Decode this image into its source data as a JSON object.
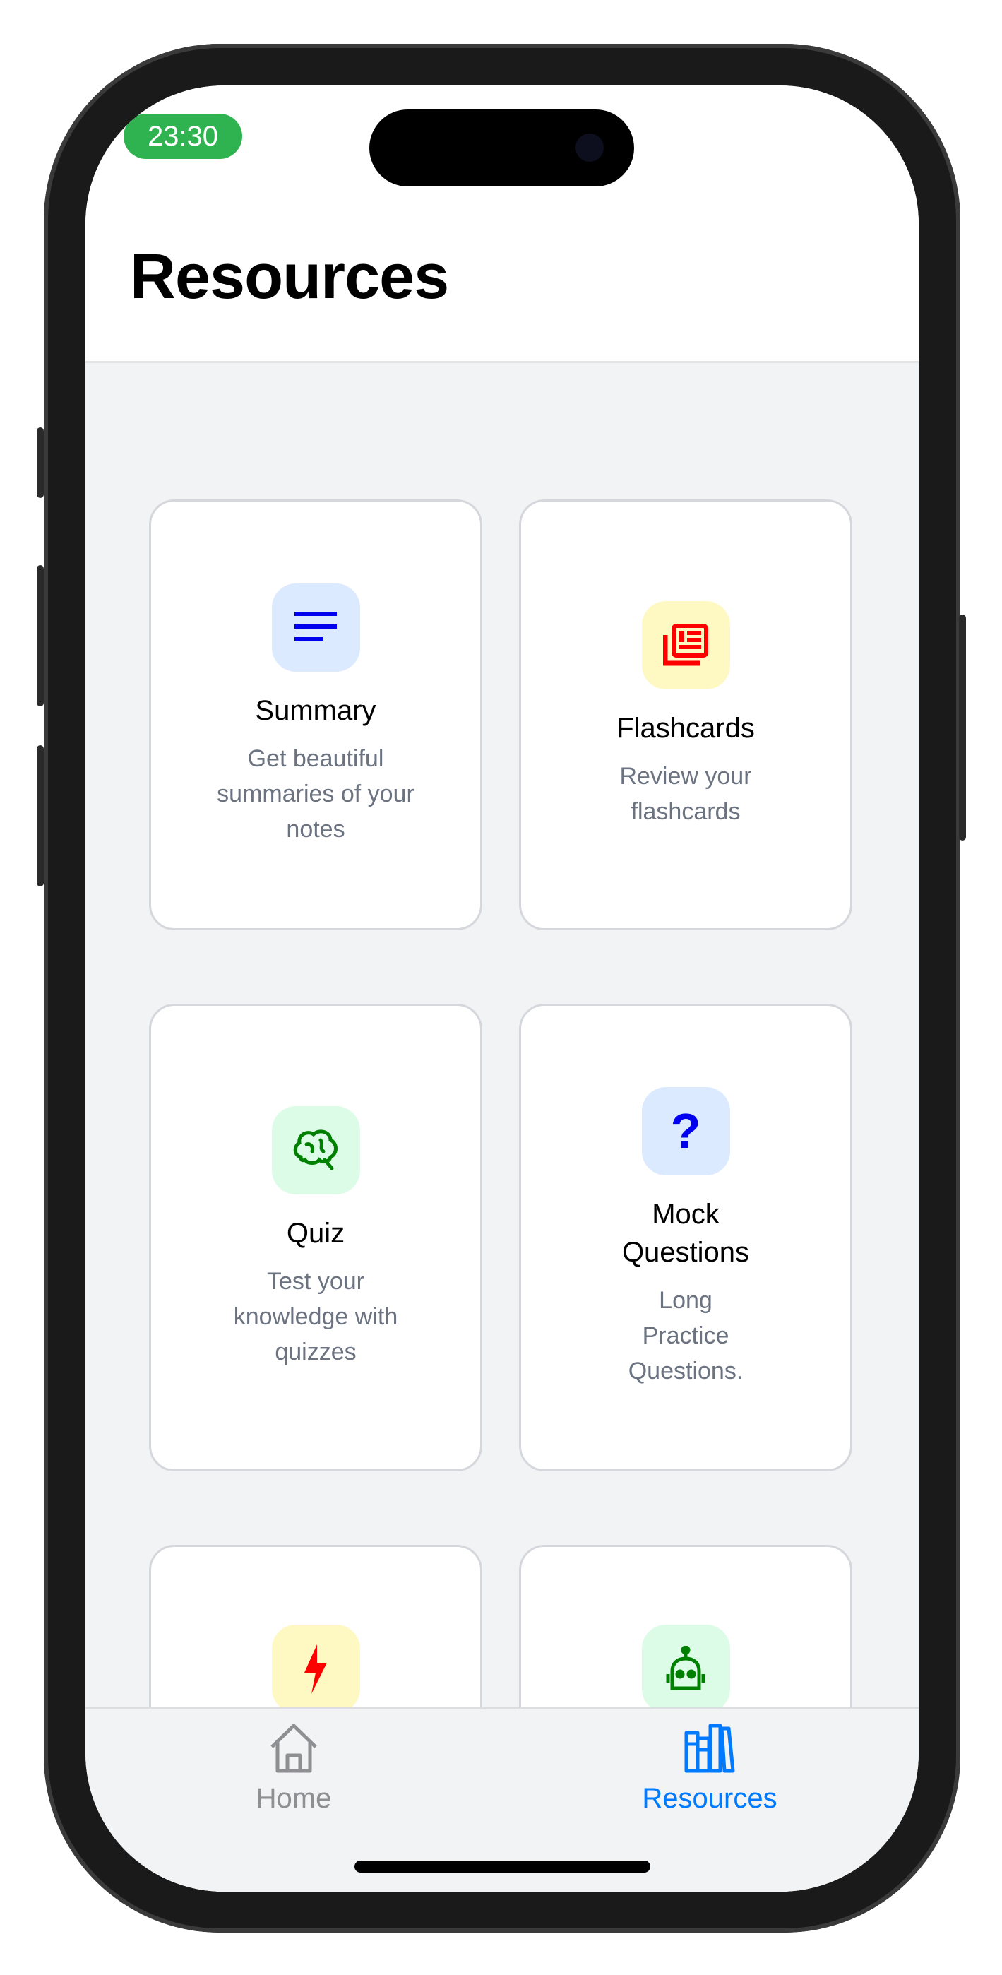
{
  "status_bar": {
    "time": "23:30"
  },
  "header": {
    "title": "Resources"
  },
  "cards": [
    {
      "title": "Summary",
      "description": "Get beautiful summaries of your notes",
      "icon": "text-lines-icon",
      "icon_bg": "#dbeafe",
      "icon_color": "#0000ee"
    },
    {
      "title": "Flashcards",
      "description": "Review your flashcards",
      "icon": "newspaper-stack-icon",
      "icon_bg": "#fef9c3",
      "icon_color": "#ff0000"
    },
    {
      "title": "Quiz",
      "description": "Test your knowledge with quizzes",
      "icon": "brain-icon",
      "icon_bg": "#dcfce7",
      "icon_color": "#008000"
    },
    {
      "title": "Mock Questions",
      "description": "Long Practice Questions.",
      "icon": "question-mark-icon",
      "icon_bg": "#dbeafe",
      "icon_color": "#0000ee"
    },
    {
      "title": "",
      "description": "",
      "icon": "lightning-bolt-icon",
      "icon_bg": "#fef9c3",
      "icon_color": "#ff0000"
    },
    {
      "title": "",
      "description": "",
      "icon": "robot-icon",
      "icon_bg": "#dcfce7",
      "icon_color": "#008000"
    }
  ],
  "tabs": [
    {
      "label": "Home",
      "active": false,
      "color": "#8e8e93"
    },
    {
      "label": "Resources",
      "active": true,
      "color": "#007aff"
    }
  ]
}
